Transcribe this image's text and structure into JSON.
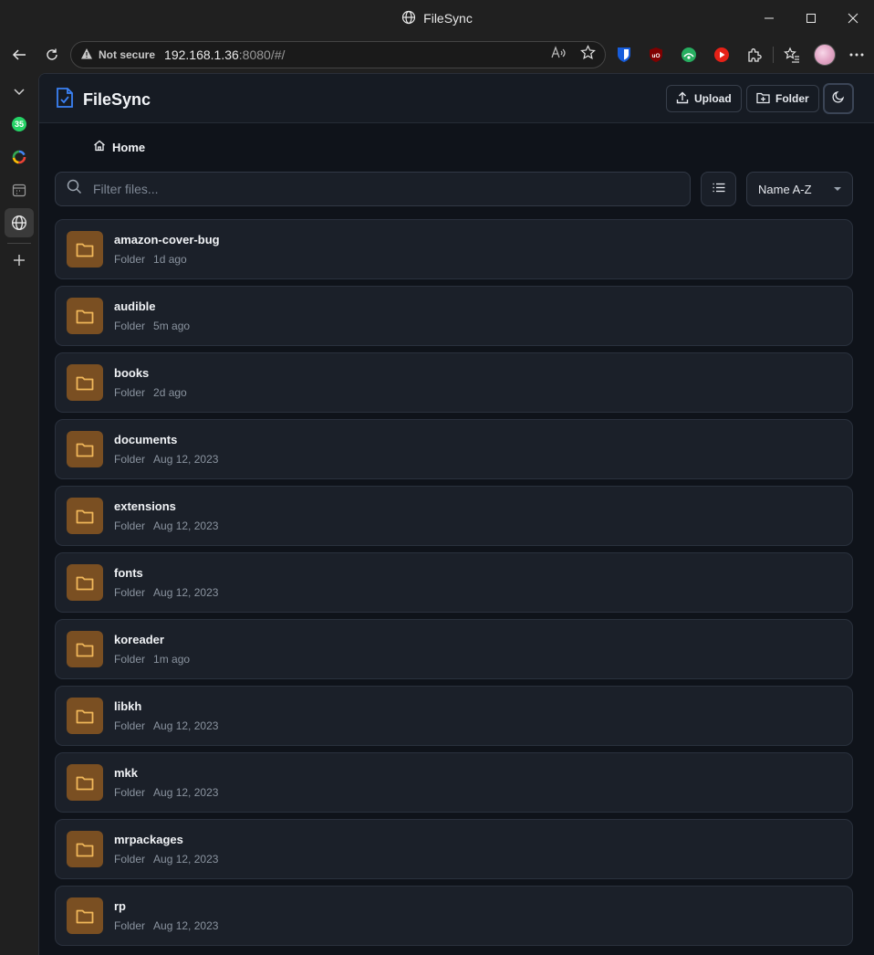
{
  "window": {
    "title": "FileSync"
  },
  "address_bar": {
    "security_label": "Not secure",
    "url_host": "192.168.1.36",
    "url_rest": ":8080/#/"
  },
  "rail": {
    "badge_count": "35"
  },
  "app": {
    "brand": "FileSync",
    "upload_label": "Upload",
    "folder_label": "Folder",
    "breadcrumb_home": "Home",
    "search_placeholder": "Filter files...",
    "sort_value": "Name A-Z",
    "accent_color": "#3b82f6",
    "folder_icon_color": "#f0b75a"
  },
  "files": [
    {
      "name": "amazon-cover-bug",
      "type": "Folder",
      "modified": "1d ago"
    },
    {
      "name": "audible",
      "type": "Folder",
      "modified": "5m ago"
    },
    {
      "name": "books",
      "type": "Folder",
      "modified": "2d ago"
    },
    {
      "name": "documents",
      "type": "Folder",
      "modified": "Aug 12, 2023"
    },
    {
      "name": "extensions",
      "type": "Folder",
      "modified": "Aug 12, 2023"
    },
    {
      "name": "fonts",
      "type": "Folder",
      "modified": "Aug 12, 2023"
    },
    {
      "name": "koreader",
      "type": "Folder",
      "modified": "1m ago"
    },
    {
      "name": "libkh",
      "type": "Folder",
      "modified": "Aug 12, 2023"
    },
    {
      "name": "mkk",
      "type": "Folder",
      "modified": "Aug 12, 2023"
    },
    {
      "name": "mrpackages",
      "type": "Folder",
      "modified": "Aug 12, 2023"
    },
    {
      "name": "rp",
      "type": "Folder",
      "modified": "Aug 12, 2023"
    }
  ]
}
